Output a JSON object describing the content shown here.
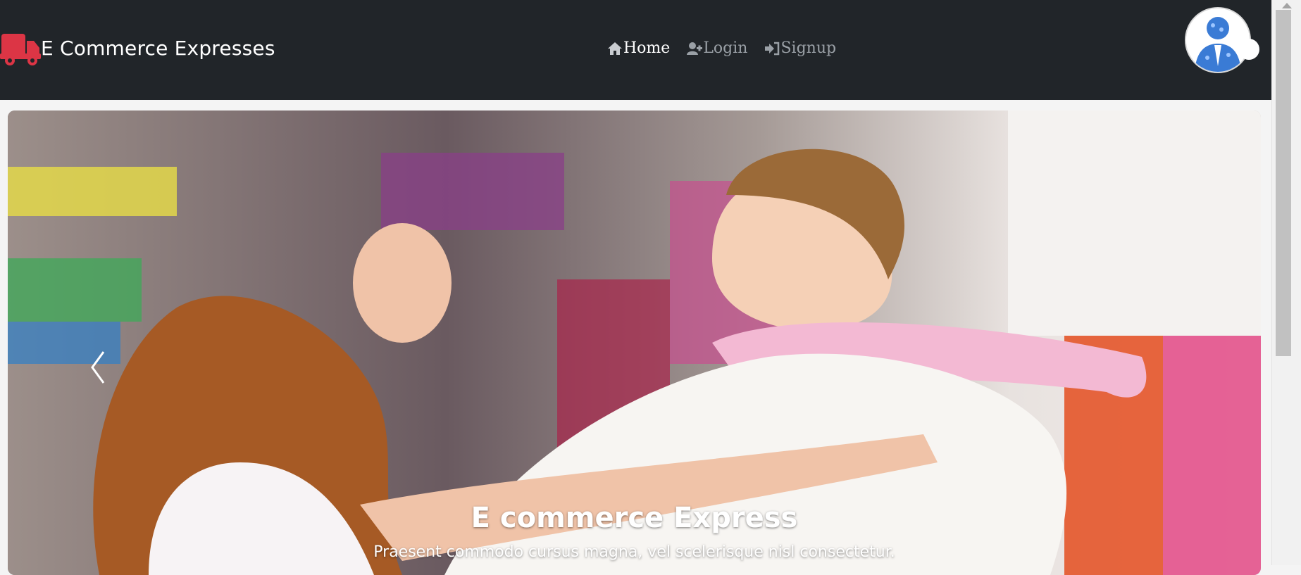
{
  "navbar": {
    "brand_label": "E Commerce Expresses",
    "brand_icon": "truck-icon",
    "links": [
      {
        "label": "Home",
        "icon": "home-icon",
        "active": true
      },
      {
        "label": "Login",
        "icon": "user-plus-icon",
        "active": false
      },
      {
        "label": "Signup",
        "icon": "sign-in-icon",
        "active": false
      }
    ],
    "avatar_icon": "user-avatar"
  },
  "carousel": {
    "caption_title": "E commerce Express",
    "caption_text": "Praesent commodo cursus magna, vel scelerisque nisl consectetur.",
    "prev_icon": "chevron-left-icon"
  },
  "colors": {
    "navbar_bg": "#212529",
    "brand_icon": "#dc3545",
    "link_active": "#ffffff",
    "link_muted": "#9aa0a6"
  }
}
